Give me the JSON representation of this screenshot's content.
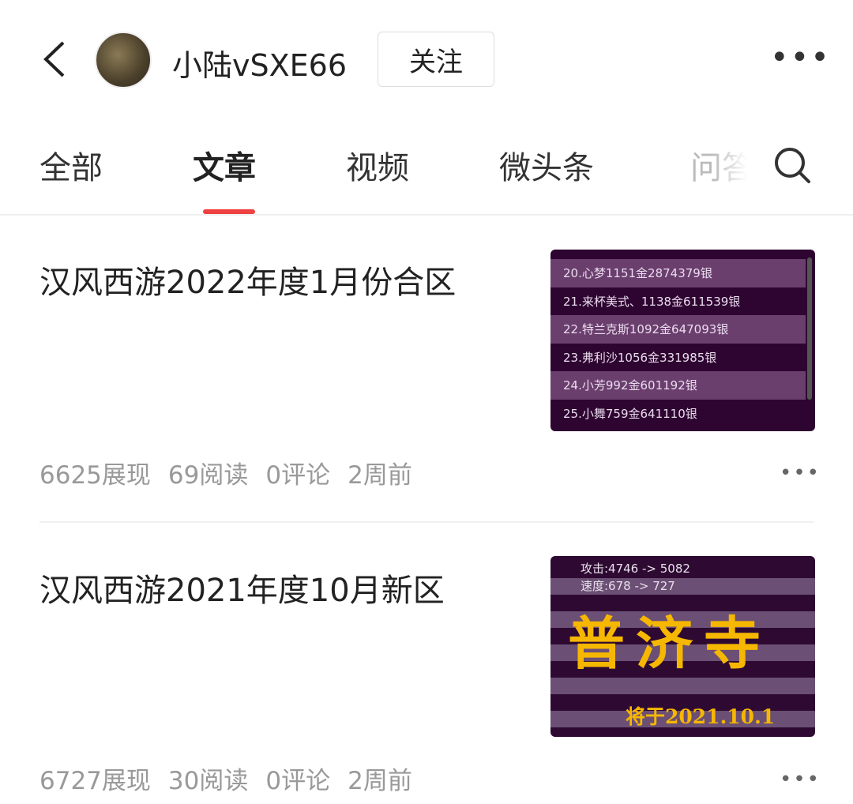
{
  "header": {
    "username": "小陆vSXE66",
    "follow_label": "关注",
    "more_icon": "more-icon"
  },
  "tabs": [
    {
      "label": "全部"
    },
    {
      "label": "文章",
      "active": true
    },
    {
      "label": "视频"
    },
    {
      "label": "微头条"
    },
    {
      "label": "问答"
    }
  ],
  "colors": {
    "accent": "#f04142"
  },
  "articles": [
    {
      "title": "汉风西游2022年度1月份合区",
      "stats": {
        "views": "6625展现",
        "reads": "69阅读",
        "comments": "0评论",
        "time": "2周前"
      },
      "thumb_rows": [
        "20.心梦1151金2874379银",
        "21.来杯美式、1138金611539银",
        "22.特兰克斯1092金647093银",
        "23.弗利沙1056金331985银",
        "24.小芳992金601192银",
        "25.小舞759金641110银"
      ]
    },
    {
      "title": "汉风西游2021年度10月新区",
      "stats": {
        "views": "6727展现",
        "reads": "30阅读",
        "comments": "0评论",
        "time": "2周前"
      },
      "thumb_lines": [
        "攻击:4746 -> 5082",
        "速度:678 -> 727"
      ],
      "thumb_big": "普济寺",
      "thumb_date": "将于2021.10.1"
    }
  ]
}
